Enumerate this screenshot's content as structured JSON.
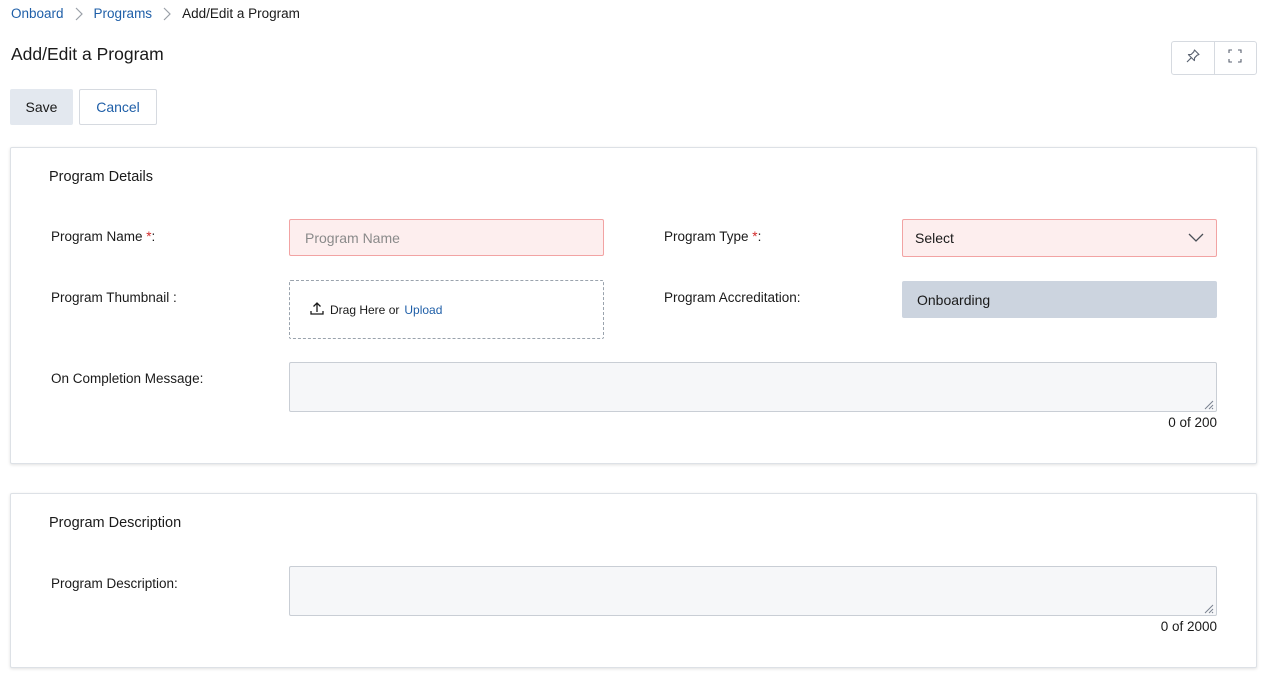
{
  "breadcrumb": {
    "items": [
      "Onboard",
      "Programs"
    ],
    "current": "Add/Edit a Program"
  },
  "page": {
    "title": "Add/Edit a Program"
  },
  "toolbar": {
    "save_label": "Save",
    "cancel_label": "Cancel"
  },
  "tools": {
    "pin_icon": "pin-icon",
    "fullscreen_icon": "fullscreen-icon"
  },
  "details": {
    "title": "Program Details",
    "program_name": {
      "label": "Program Name ",
      "required_mark": "*",
      "suffix": ":",
      "placeholder": "Program Name",
      "value": ""
    },
    "program_type": {
      "label": "Program Type ",
      "required_mark": "*",
      "suffix": ":",
      "selected": "Select"
    },
    "thumbnail": {
      "label": "Program Thumbnail :",
      "drag_text": "Drag Here or",
      "upload_label": "Upload"
    },
    "accreditation": {
      "label": "Program Accreditation:",
      "value": "Onboarding"
    },
    "completion": {
      "label": "On Completion Message:",
      "value": "",
      "counter": "0 of 200"
    }
  },
  "description": {
    "title": "Program Description",
    "field": {
      "label": "Program Description:",
      "value": "",
      "counter": "0 of 2000"
    }
  },
  "colors": {
    "link": "#1f5fa8",
    "required": "#d12a2a",
    "error_bg": "#fdeeee",
    "error_border": "#f2a3a3",
    "readonly_bg": "#ccd4df"
  }
}
